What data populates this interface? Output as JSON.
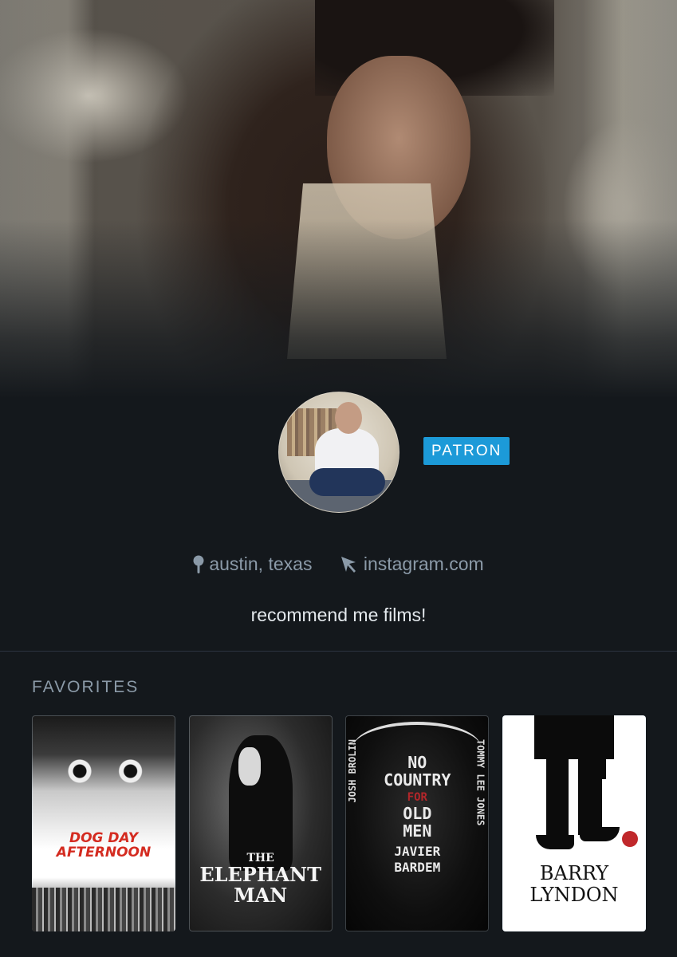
{
  "profile": {
    "badge": "PATRON",
    "location": "austin, texas",
    "website": "instagram.com",
    "bio": "recommend me films!"
  },
  "favorites": {
    "title": "FAVORITES",
    "films": [
      {
        "title_line1": "DOG DAY",
        "title_line2": "AFTERNOON"
      },
      {
        "title_line1": "THE",
        "title_line2": "ELEPHANT",
        "title_line3": "MAN"
      },
      {
        "top_left": "JOSH BROLIN",
        "top_right": "TOMMY LEE JONES",
        "title_line1": "NO",
        "title_line2": "COUNTRY",
        "title_line3": "FOR",
        "title_line4": "OLD",
        "title_line5": "MEN",
        "credit1": "JAVIER",
        "credit2": "BARDEM"
      },
      {
        "title_line1": "BARRY",
        "title_line2": "LYNDON"
      }
    ]
  },
  "colors": {
    "background": "#14181c",
    "badge": "#1c9ad8",
    "muted_text": "#8b9aa8",
    "text": "#e3e8ec"
  },
  "icons": [
    "location-pin-icon",
    "cursor-arrow-icon"
  ]
}
